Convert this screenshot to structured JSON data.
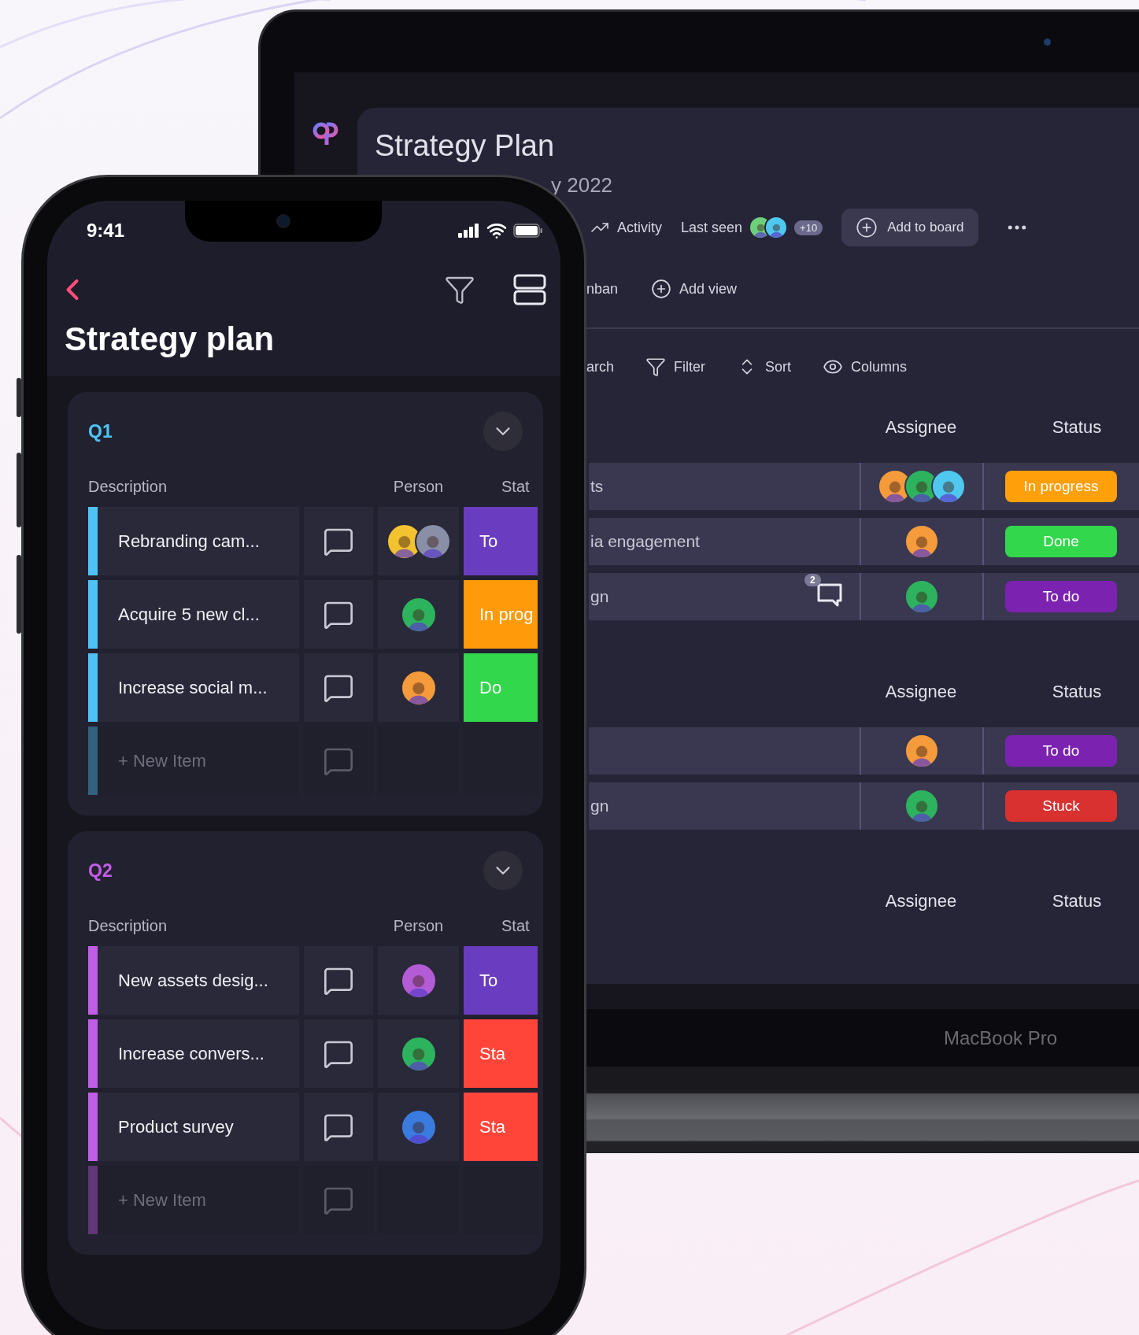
{
  "laptop": {
    "brand_label": "MacBook Pro",
    "app": {
      "title": "Strategy Plan",
      "subtitle": "y 2022",
      "toolbar": {
        "activity": "Activity",
        "last_seen": "Last seen",
        "viewers": [
          {
            "color": "#6dcf7a"
          },
          {
            "color": "#4fc8f0"
          }
        ],
        "viewer_count": "+10",
        "add_to_board": "Add to board"
      },
      "views": [
        {
          "label": "nban",
          "kind": "text"
        },
        {
          "label": "Add view",
          "kind": "add"
        }
      ],
      "actions": [
        {
          "label": "arch",
          "kind": "text"
        },
        {
          "label": "Filter",
          "kind": "filter"
        },
        {
          "label": "Sort",
          "kind": "sort"
        },
        {
          "label": "Columns",
          "kind": "columns"
        }
      ],
      "groups": [
        {
          "columns": [
            "Assignee",
            "Status"
          ],
          "rows": [
            {
              "name": "ts",
              "assignees": [
                {
                  "color": "#f59b3c"
                },
                {
                  "color": "#2db35d"
                },
                {
                  "color": "#4fc8f0"
                }
              ],
              "status": "In progress",
              "color": "#ff9f0a"
            },
            {
              "name": "ia engagement",
              "assignees": [
                {
                  "color": "#f59b3c"
                }
              ],
              "status": "Done",
              "color": "#32d74b"
            },
            {
              "name": "gn",
              "comment_count": "2",
              "assignees": [
                {
                  "color": "#2db35d"
                }
              ],
              "status": "To do",
              "color": "#7b22b0"
            }
          ]
        },
        {
          "columns": [
            "Assignee",
            "Status"
          ],
          "rows": [
            {
              "assignees": [
                {
                  "color": "#f59b3c"
                }
              ],
              "status": "To do",
              "color": "#7b22b0"
            },
            {
              "name": "gn",
              "assignees": [
                {
                  "color": "#2db35d"
                }
              ],
              "status": "Stuck",
              "color": "#d93030"
            }
          ]
        },
        {
          "columns": [
            "Assignee",
            "Status"
          ]
        }
      ]
    }
  },
  "phone": {
    "time": "9:41",
    "title": "Strategy plan",
    "sections": [
      {
        "label": "Q1",
        "color": "#4fc3f7",
        "columns": [
          "Description",
          "Person",
          "Stat"
        ],
        "new_item": "+ New Item",
        "rows": [
          {
            "description": "Rebranding cam...",
            "avatars": [
              {
                "color": "#f2c230"
              },
              {
                "color": "#8a8fa8"
              }
            ],
            "status": "To",
            "color": "#6a3cc0"
          },
          {
            "description": "Acquire 5 new cl...",
            "avatars": [
              {
                "color": "#2db35d"
              }
            ],
            "status": "In prog",
            "color": "#ff9a0a"
          },
          {
            "description": "Increase social m...",
            "avatars": [
              {
                "color": "#f59b3c"
              }
            ],
            "status": "Do",
            "color": "#32d74b"
          }
        ]
      },
      {
        "label": "Q2",
        "color": "#c25de8",
        "columns": [
          "Description",
          "Person",
          "Stat"
        ],
        "new_item": "+ New Item",
        "rows": [
          {
            "description": "New assets desig...",
            "avatars": [
              {
                "color": "#b45bd6"
              }
            ],
            "status": "To",
            "color": "#6a3cc0"
          },
          {
            "description": "Increase convers...",
            "avatars": [
              {
                "color": "#2db35d"
              }
            ],
            "status": "Sta",
            "color": "#ff453a"
          },
          {
            "description": "Product survey",
            "avatars": [
              {
                "color": "#3a7be0"
              }
            ],
            "status": "Sta",
            "color": "#ff453a"
          }
        ]
      }
    ]
  }
}
